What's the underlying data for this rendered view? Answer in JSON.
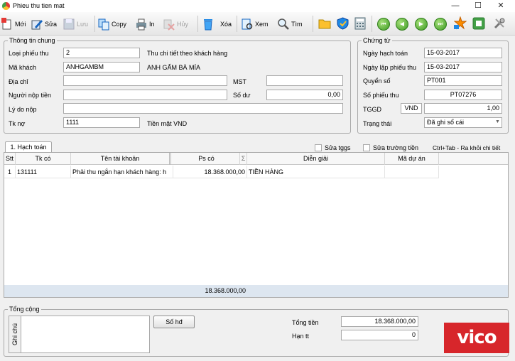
{
  "window": {
    "title": "Phieu thu tien mat",
    "minimize": "—",
    "maximize": "☐",
    "close": "✕"
  },
  "toolbar": {
    "new_label": "Mới",
    "edit_label": "Sửa",
    "save_label": "Lưu",
    "copy_label": "Copy",
    "print_label": "In",
    "cancel_label": "Hủy",
    "delete_label": "Xóa",
    "view_label": "Xem",
    "find_label": "Tìm"
  },
  "general_info": {
    "legend": "Thông tin chung",
    "receipt_type_label": "Loại phiếu thu",
    "receipt_type_value": "2",
    "receipt_type_desc": "Thu chi tiết theo khách hàng",
    "customer_label": "Mã khách",
    "customer_code": "ANHGAMBM",
    "customer_name": "ANH GẤM BÀ MÍA",
    "address_label": "Địa chỉ",
    "address_value": "",
    "tax_label": "MST",
    "tax_value": "",
    "payer_label": "Người nộp tiền",
    "payer_value": "",
    "balance_label": "Số dư",
    "balance_value": "0,00",
    "reason_label": "Lý do nộp",
    "reason_value": "",
    "debit_label": "Tk nợ",
    "debit_value": "1111",
    "debit_desc": "Tiền mặt VND"
  },
  "voucher": {
    "legend": "Chứng từ",
    "posting_date_label": "Ngày hạch toán",
    "posting_date": "15-03-2017",
    "voucher_date_label": "Ngày lập phiếu thu",
    "voucher_date": "15-03-2017",
    "book_label": "Quyển số",
    "book_value": "PT001",
    "number_label": "Số phiếu thu",
    "number_value": "PT07276",
    "rate_label": "TGGD",
    "currency": "VND",
    "rate_value": "1,00",
    "status_label": "Trạng thái",
    "status_value": "Đã ghi sổ cái"
  },
  "tabs": {
    "accounting": "1. Hạch toán"
  },
  "options": {
    "edit_rate": "Sửa tggs",
    "edit_fields": "Sửa trường tiền",
    "hint": "Ctrl+Tab - Ra khỏi chi tiết"
  },
  "grid": {
    "headers": {
      "stt": "Stt",
      "credit_account": "Tk có",
      "account_name": "Tên tài khoản",
      "amount": "Ps có",
      "sum_icon": "Σ",
      "description": "Diễn giải",
      "project": "Mã dự án"
    },
    "rows": [
      {
        "stt": "1",
        "credit_account": "131111",
        "account_name": "Phải thu ngắn hạn khách hàng: h",
        "amount": "18.368.000,00",
        "description": "TIỀN HÀNG",
        "project": ""
      }
    ],
    "total": "18.368.000,00"
  },
  "totals": {
    "legend": "Tổng cộng",
    "note_label": "Ghi chú",
    "note_value": "",
    "invoice_button": "Số hđ",
    "total_label": "Tổng tiền",
    "total_value": "18.368.000,00",
    "due_label": "Hạn tt",
    "due_value": "0"
  },
  "watermark": {
    "text": "vico"
  },
  "colors": {
    "accent_green": "#3d9a22",
    "watermark_red": "#d7262b",
    "footer_bar": "#dde6f0"
  }
}
